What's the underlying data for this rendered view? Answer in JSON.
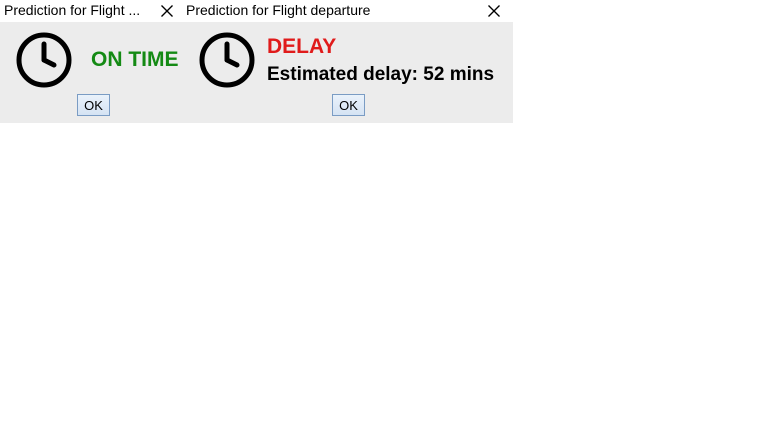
{
  "dialogs": {
    "ontime": {
      "title": "Prediction for Flight ...",
      "status": "ON TIME",
      "status_color": "#148a14",
      "ok_label": "OK",
      "icon": "clock-icon"
    },
    "delay": {
      "title": "Prediction for Flight departure",
      "status": "DELAY",
      "status_color": "#e01b1b",
      "detail": "Estimated delay: 52 mins",
      "ok_label": "OK",
      "icon": "clock-icon"
    }
  },
  "icons": {
    "close": "close-icon"
  },
  "colors": {
    "dialog_background": "#ececec",
    "titlebar_background": "#ffffff"
  }
}
